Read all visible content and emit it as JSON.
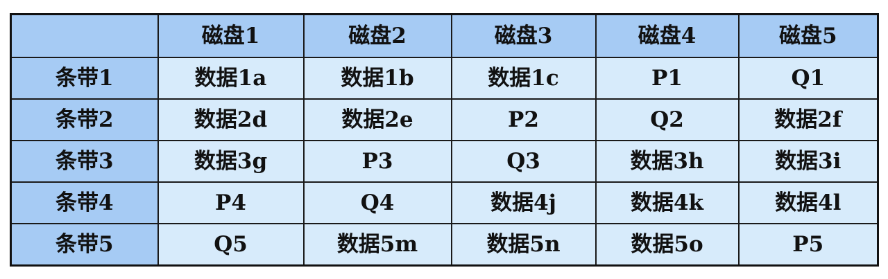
{
  "table": {
    "corner": "",
    "columns": [
      "磁盘1",
      "磁盘2",
      "磁盘3",
      "磁盘4",
      "磁盘5"
    ],
    "rows": [
      {
        "label": "条带1",
        "cells": [
          "数据1a",
          "数据1b",
          "数据1c",
          "P1",
          "Q1"
        ]
      },
      {
        "label": "条带2",
        "cells": [
          "数据2d",
          "数据2e",
          "P2",
          "Q2",
          "数据2f"
        ]
      },
      {
        "label": "条带3",
        "cells": [
          "数据3g",
          "P3",
          "Q3",
          "数据3h",
          "数据3i"
        ]
      },
      {
        "label": "条带4",
        "cells": [
          "P4",
          "Q4",
          "数据4j",
          "数据4k",
          "数据4l"
        ]
      },
      {
        "label": "条带5",
        "cells": [
          "Q5",
          "数据5m",
          "数据5n",
          "数据5o",
          "P5"
        ]
      }
    ]
  },
  "colors": {
    "header_bg": "#a6cbf4",
    "cell_bg": "#d7ebfb",
    "border": "#1a1a1a"
  }
}
